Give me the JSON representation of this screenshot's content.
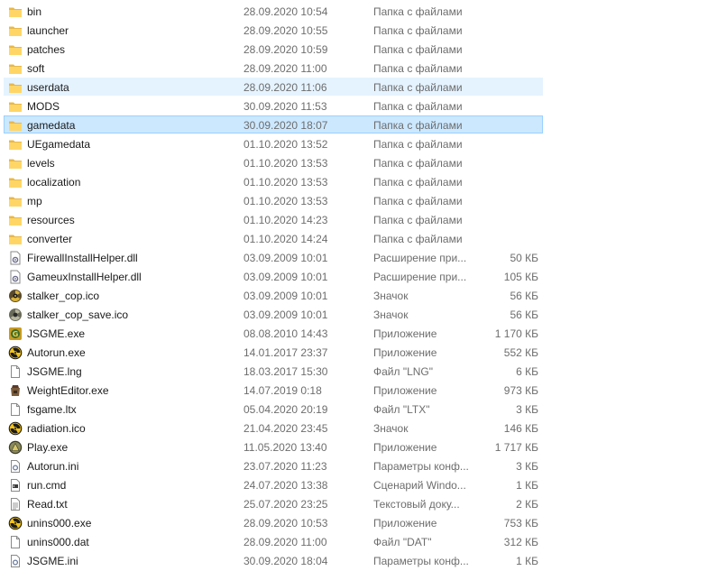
{
  "files": [
    {
      "name": "bin",
      "date": "28.09.2020 10:54",
      "type": "Папка с файлами",
      "size": "",
      "icon": "folder-icon"
    },
    {
      "name": "launcher",
      "date": "28.09.2020 10:55",
      "type": "Папка с файлами",
      "size": "",
      "icon": "folder-icon"
    },
    {
      "name": "patches",
      "date": "28.09.2020 10:59",
      "type": "Папка с файлами",
      "size": "",
      "icon": "folder-icon"
    },
    {
      "name": "soft",
      "date": "28.09.2020 11:00",
      "type": "Папка с файлами",
      "size": "",
      "icon": "folder-icon"
    },
    {
      "name": "userdata",
      "date": "28.09.2020 11:06",
      "type": "Папка с файлами",
      "size": "",
      "icon": "folder-icon",
      "state": "hover"
    },
    {
      "name": "MODS",
      "date": "30.09.2020 11:53",
      "type": "Папка с файлами",
      "size": "",
      "icon": "folder-icon"
    },
    {
      "name": "gamedata",
      "date": "30.09.2020 18:07",
      "type": "Папка с файлами",
      "size": "",
      "icon": "folder-icon",
      "state": "selected"
    },
    {
      "name": "UEgamedata",
      "date": "01.10.2020 13:52",
      "type": "Папка с файлами",
      "size": "",
      "icon": "folder-icon"
    },
    {
      "name": "levels",
      "date": "01.10.2020 13:53",
      "type": "Папка с файлами",
      "size": "",
      "icon": "folder-icon"
    },
    {
      "name": "localization",
      "date": "01.10.2020 13:53",
      "type": "Папка с файлами",
      "size": "",
      "icon": "folder-icon"
    },
    {
      "name": "mp",
      "date": "01.10.2020 13:53",
      "type": "Папка с файлами",
      "size": "",
      "icon": "folder-icon"
    },
    {
      "name": "resources",
      "date": "01.10.2020 14:23",
      "type": "Папка с файлами",
      "size": "",
      "icon": "folder-icon"
    },
    {
      "name": "converter",
      "date": "01.10.2020 14:24",
      "type": "Папка с файлами",
      "size": "",
      "icon": "folder-icon"
    },
    {
      "name": "FirewallInstallHelper.dll",
      "date": "03.09.2009 10:01",
      "type": "Расширение при...",
      "size": "50 КБ",
      "icon": "dll-file-icon"
    },
    {
      "name": "GameuxInstallHelper.dll",
      "date": "03.09.2009 10:01",
      "type": "Расширение при...",
      "size": "105 КБ",
      "icon": "dll-file-icon"
    },
    {
      "name": "stalker_cop.ico",
      "date": "03.09.2009 10:01",
      "type": "Значок",
      "size": "56 КБ",
      "icon": "stalker-icon"
    },
    {
      "name": "stalker_cop_save.ico",
      "date": "03.09.2009 10:01",
      "type": "Значок",
      "size": "56 КБ",
      "icon": "stalker-save-icon"
    },
    {
      "name": "JSGME.exe",
      "date": "08.08.2010 14:43",
      "type": "Приложение",
      "size": "1 170 КБ",
      "icon": "jsgme-app-icon"
    },
    {
      "name": "Autorun.exe",
      "date": "14.01.2017 23:37",
      "type": "Приложение",
      "size": "552 КБ",
      "icon": "radiation-icon"
    },
    {
      "name": "JSGME.lng",
      "date": "18.03.2017 15:30",
      "type": "Файл \"LNG\"",
      "size": "6 КБ",
      "icon": "blank-file-icon"
    },
    {
      "name": "WeightEditor.exe",
      "date": "14.07.2019 0:18",
      "type": "Приложение",
      "size": "973 КБ",
      "icon": "weight-editor-icon"
    },
    {
      "name": "fsgame.ltx",
      "date": "05.04.2020 20:19",
      "type": "Файл \"LTX\"",
      "size": "3 КБ",
      "icon": "blank-file-icon"
    },
    {
      "name": "radiation.ico",
      "date": "21.04.2020 23:45",
      "type": "Значок",
      "size": "146 КБ",
      "icon": "radiation-icon"
    },
    {
      "name": "Play.exe",
      "date": "11.05.2020 13:40",
      "type": "Приложение",
      "size": "1 717 КБ",
      "icon": "play-app-icon"
    },
    {
      "name": "Autorun.ini",
      "date": "23.07.2020 11:23",
      "type": "Параметры конф...",
      "size": "3 КБ",
      "icon": "ini-file-icon"
    },
    {
      "name": "run.cmd",
      "date": "24.07.2020 13:38",
      "type": "Сценарий Windo...",
      "size": "1 КБ",
      "icon": "cmd-file-icon"
    },
    {
      "name": "Read.txt",
      "date": "25.07.2020 23:25",
      "type": "Текстовый доку...",
      "size": "2 КБ",
      "icon": "text-file-icon"
    },
    {
      "name": "unins000.exe",
      "date": "28.09.2020 10:53",
      "type": "Приложение",
      "size": "753 КБ",
      "icon": "radiation-icon"
    },
    {
      "name": "unins000.dat",
      "date": "28.09.2020 11:00",
      "type": "Файл \"DAT\"",
      "size": "312 КБ",
      "icon": "blank-file-icon"
    },
    {
      "name": "JSGME.ini",
      "date": "30.09.2020 18:04",
      "type": "Параметры конф...",
      "size": "1 КБ",
      "icon": "ini-file-icon"
    }
  ],
  "colors": {
    "folder": "#ffd666",
    "hover_bg": "#e5f3ff",
    "selected_bg": "#cce8ff",
    "selected_border": "#99d1ff",
    "secondary_text": "#6d6d6d"
  }
}
